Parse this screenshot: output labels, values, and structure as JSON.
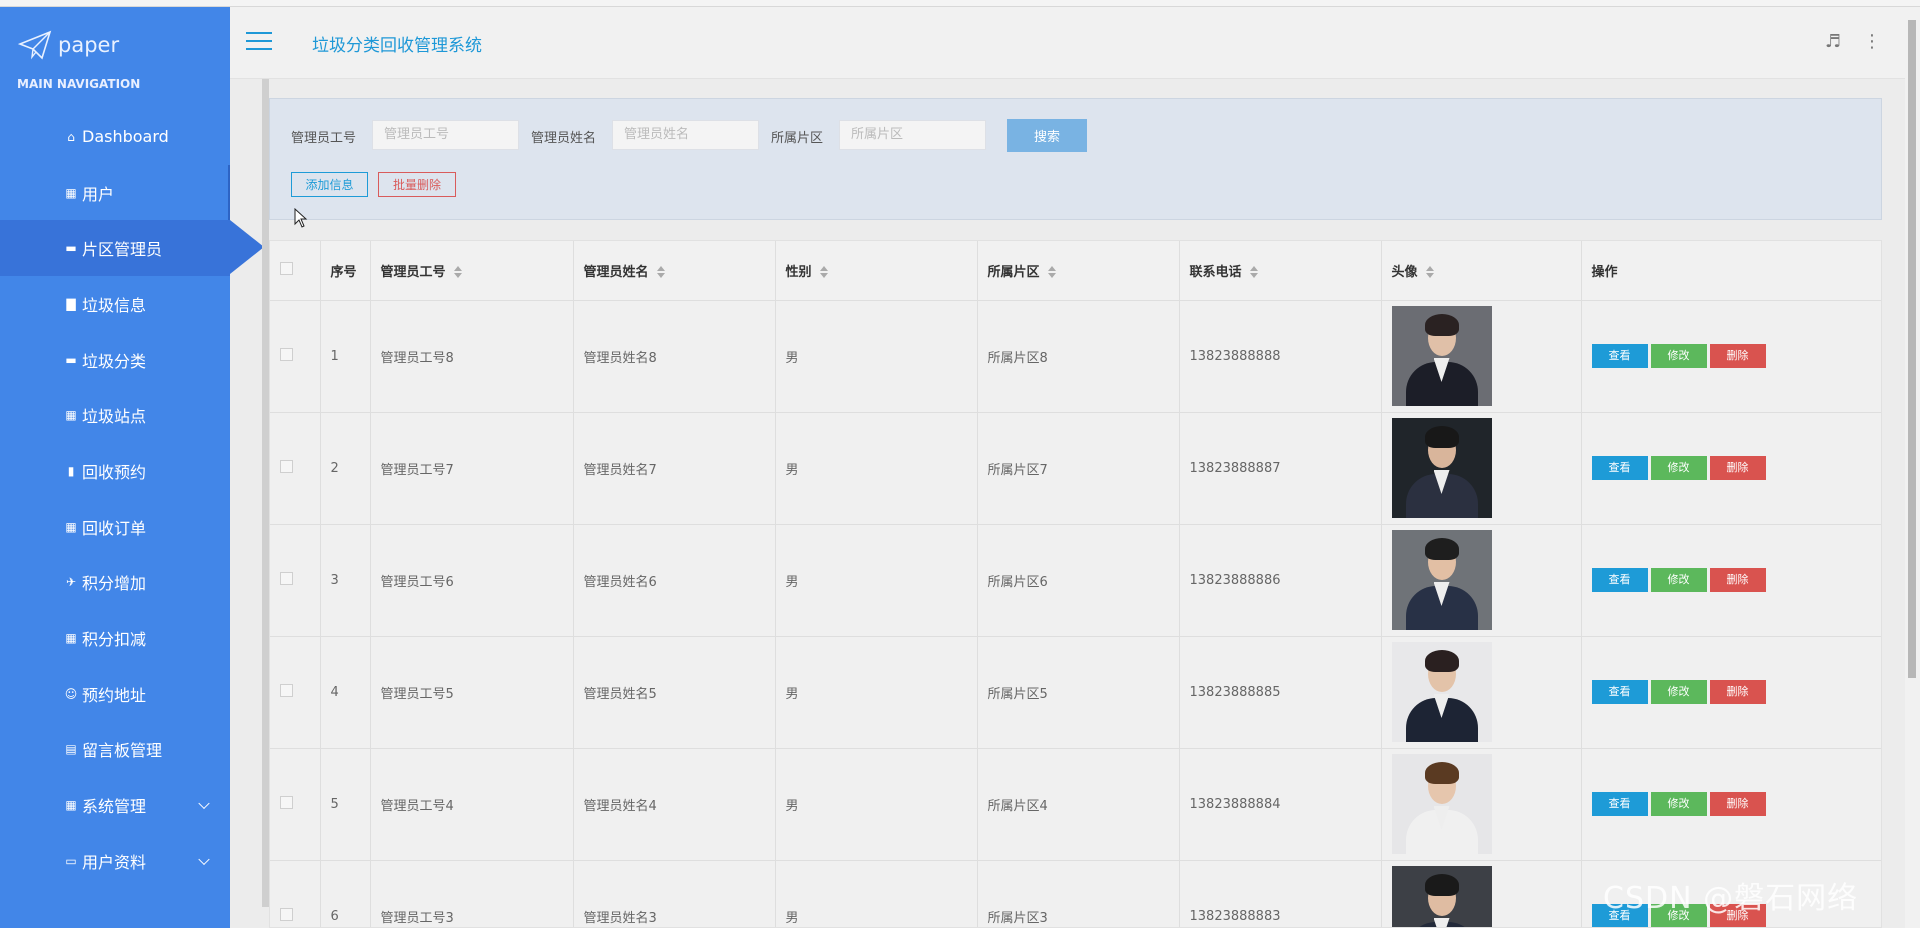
{
  "sidebar": {
    "logo_text": "paper",
    "nav_heading": "MAIN NAVIGATION",
    "items": [
      {
        "label": "Dashboard",
        "icon": "home-icon"
      },
      {
        "label": "用户",
        "icon": "grid-icon"
      },
      {
        "label": "片区管理员",
        "icon": "comment-icon"
      },
      {
        "label": "垃圾信息",
        "icon": "bar-chart-icon"
      },
      {
        "label": "垃圾分类",
        "icon": "comment-icon"
      },
      {
        "label": "垃圾站点",
        "icon": "grid-icon"
      },
      {
        "label": "回收预约",
        "icon": "briefcase-icon"
      },
      {
        "label": "回收订单",
        "icon": "grid-icon"
      },
      {
        "label": "积分增加",
        "icon": "plane-icon"
      },
      {
        "label": "积分扣减",
        "icon": "grid-icon"
      },
      {
        "label": "预约地址",
        "icon": "user-icon"
      },
      {
        "label": "留言板管理",
        "icon": "clipboard-icon"
      },
      {
        "label": "系统管理",
        "icon": "grid-icon"
      },
      {
        "label": "用户资料",
        "icon": "card-icon"
      }
    ],
    "active_index": 2,
    "accent": "#4286e8"
  },
  "header": {
    "title": "垃圾分类回收管理系统"
  },
  "search": {
    "field1_label": "管理员工号",
    "field1_placeholder": "管理员工号",
    "field2_label": "管理员姓名",
    "field2_placeholder": "管理员姓名",
    "field3_label": "所属片区",
    "field3_placeholder": "所属片区",
    "search_button": "搜索",
    "add_button": "添加信息",
    "batch_delete_button": "批量删除"
  },
  "table": {
    "headers": [
      "序号",
      "管理员工号",
      "管理员姓名",
      "性别",
      "所属片区",
      "联系电话",
      "头像",
      "操作"
    ],
    "rows": [
      {
        "no": "1",
        "id": "管理员工号8",
        "name": "管理员姓名8",
        "gender": "男",
        "area": "所属片区8",
        "phone": "13823888888"
      },
      {
        "no": "2",
        "id": "管理员工号7",
        "name": "管理员姓名7",
        "gender": "男",
        "area": "所属片区7",
        "phone": "13823888887"
      },
      {
        "no": "3",
        "id": "管理员工号6",
        "name": "管理员姓名6",
        "gender": "男",
        "area": "所属片区6",
        "phone": "13823888886"
      },
      {
        "no": "4",
        "id": "管理员工号5",
        "name": "管理员姓名5",
        "gender": "男",
        "area": "所属片区5",
        "phone": "13823888885"
      },
      {
        "no": "5",
        "id": "管理员工号4",
        "name": "管理员姓名4",
        "gender": "男",
        "area": "所属片区4",
        "phone": "13823888884"
      },
      {
        "no": "6",
        "id": "管理员工号3",
        "name": "管理员姓名3",
        "gender": "男",
        "area": "所属片区3",
        "phone": "13823888883"
      }
    ],
    "actions": {
      "view": "查看",
      "edit": "修改",
      "delete": "删除"
    }
  },
  "watermark": "CSDN @磐石网络"
}
